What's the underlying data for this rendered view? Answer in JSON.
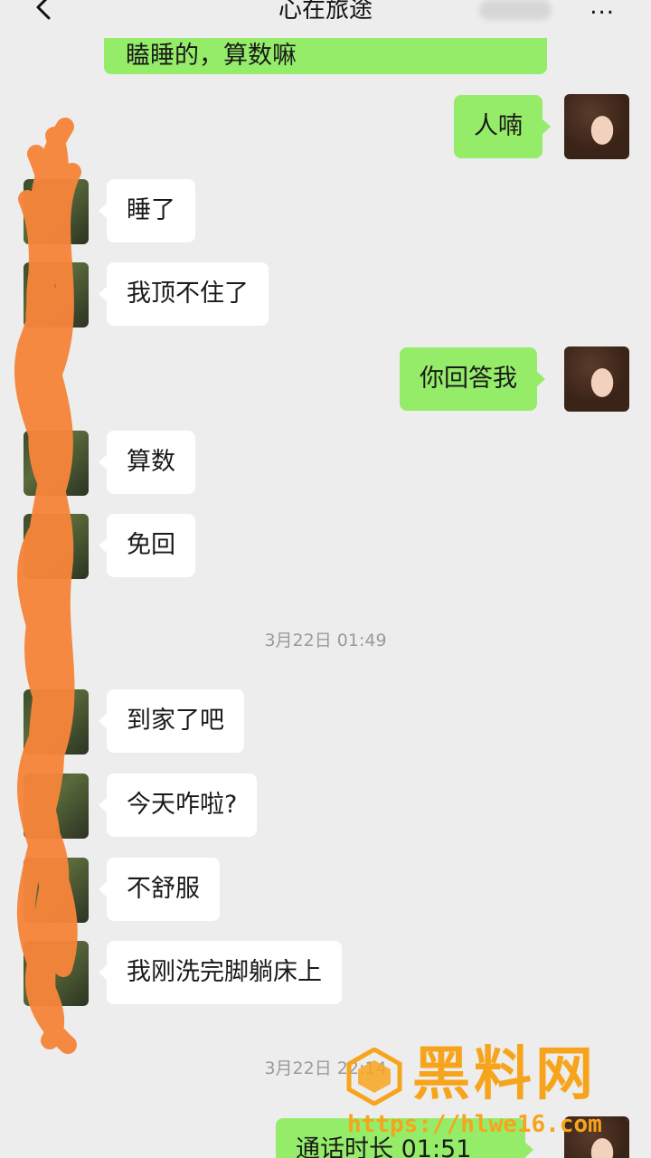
{
  "header": {
    "title": "心在旅途",
    "more": "..."
  },
  "messages": [
    {
      "side": "right",
      "text": "瞌睡的，算数嘛"
    },
    {
      "side": "right",
      "text": "人喃"
    },
    {
      "side": "left",
      "text": "睡了"
    },
    {
      "side": "left",
      "text": "我顶不住了"
    },
    {
      "side": "right",
      "text": "你回答我"
    },
    {
      "side": "left",
      "text": "算数"
    },
    {
      "side": "left",
      "text": "免回"
    },
    {
      "type": "timestamp",
      "text": "3月22日 01:49"
    },
    {
      "side": "left",
      "text": "到家了吧"
    },
    {
      "side": "left",
      "text": "今天咋啦?"
    },
    {
      "side": "left",
      "text": "不舒服"
    },
    {
      "side": "left",
      "text": "我刚洗完脚躺床上"
    },
    {
      "type": "timestamp",
      "text": "3月22日 22:14"
    },
    {
      "side": "right",
      "text": "通话时长 01:51"
    }
  ],
  "watermark": {
    "title": "黑料网",
    "url": "https://hlwe16.com"
  },
  "colors": {
    "background": "#ededed",
    "self_bubble": "#95ec69",
    "other_bubble": "#ffffff",
    "scribble": "#f6853b",
    "watermark": "#f7a41d"
  }
}
